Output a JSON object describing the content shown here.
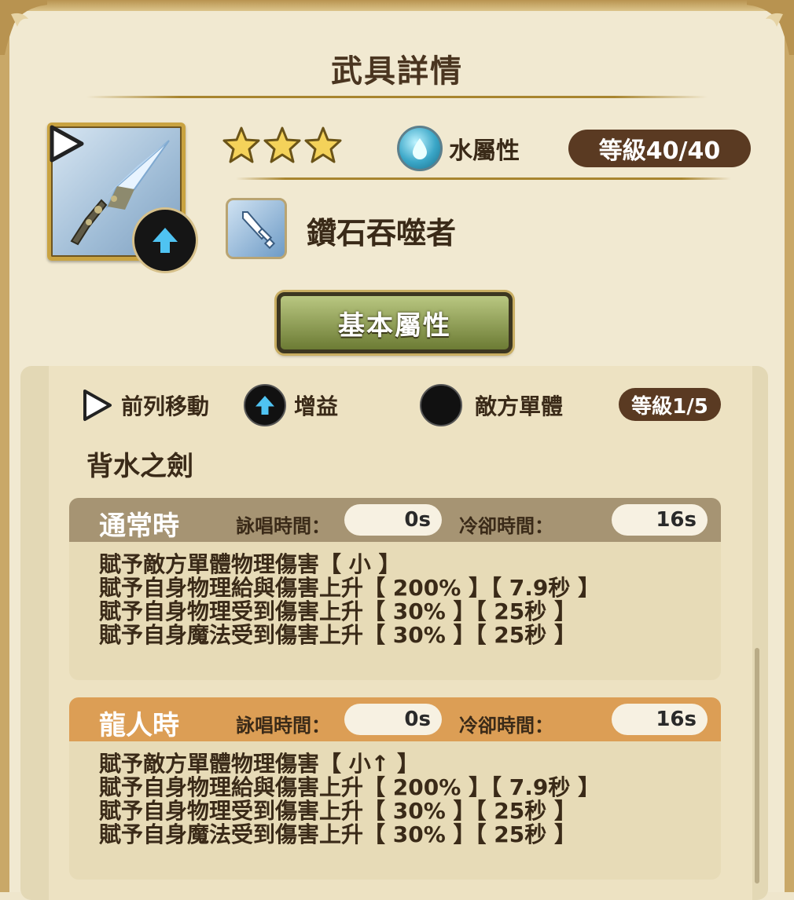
{
  "header": {
    "title": "武具詳情"
  },
  "weapon": {
    "rarity_stars": 3,
    "element_label": "水屬性",
    "level": "等級40/40",
    "name": "鑽石吞噬者",
    "element_color": "#3aa6c7"
  },
  "tab": {
    "label": "基本屬性"
  },
  "skill": {
    "tags": [
      {
        "label": "前列移動",
        "icon": "play-triangle-icon"
      },
      {
        "label": "增益",
        "icon": "up-arrow-icon"
      },
      {
        "label": "敵方單體",
        "icon": "black-circle-icon"
      }
    ],
    "level": "等級1/5",
    "name": "背水之劍",
    "modes": [
      {
        "title": "通常時",
        "cast_label": "詠唱時間：",
        "cast_value": "0s",
        "cooldown_label": "冷卻時間：",
        "cooldown_value": "16s",
        "header_color": "#a69473",
        "lines": [
          "賦予敵方單體物理傷害【 小 】",
          "賦予自身物理給與傷害上升【 200% 】【 7.9秒 】",
          "賦予自身物理受到傷害上升【 30% 】【 25秒 】",
          "賦予自身魔法受到傷害上升【 30% 】【 25秒 】"
        ]
      },
      {
        "title": "龍人時",
        "cast_label": "詠唱時間：",
        "cast_value": "0s",
        "cooldown_label": "冷卻時間：",
        "cooldown_value": "16s",
        "header_color": "#dc9e55",
        "lines": [
          "賦予敵方單體物理傷害【 小↑ 】",
          "賦予自身物理給與傷害上升【 200% 】【 7.9秒 】",
          "賦予自身物理受到傷害上升【 30% 】【 25秒 】",
          "賦予自身魔法受到傷害上升【 30% 】【 25秒 】"
        ]
      }
    ]
  }
}
